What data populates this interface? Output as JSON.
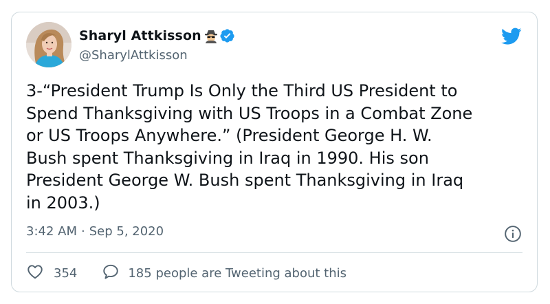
{
  "author": {
    "display_name": "Sharyl Attkisson",
    "handle": "@SharylAttkisson",
    "name_emoji": "spy-emoji",
    "verified": true
  },
  "tweet": {
    "text": "3-“President Trump Is Only the Third US President to\nSpend Thanksgiving with US Troops in a Combat Zone\nor US Troops Anywhere.” (President George H. W.\nBush spent Thanksgiving in Iraq in 1990. His son\nPresident George W. Bush spent Thanksgiving in Iraq\nin 2003.)",
    "time": "3:42 AM",
    "separator": "·",
    "date": "Sep 5, 2020"
  },
  "actions": {
    "like_count": "354",
    "reply_text": "185 people are Tweeting about this"
  },
  "icons": {
    "brand": "twitter-bird-icon",
    "verified": "verified-badge-icon",
    "info": "info-icon",
    "like": "heart-icon",
    "reply": "speech-bubble-icon"
  },
  "colors": {
    "brand_blue": "#1d9bf0",
    "text_primary": "#0f1419",
    "text_secondary": "#536471",
    "border": "#cfd9de"
  }
}
